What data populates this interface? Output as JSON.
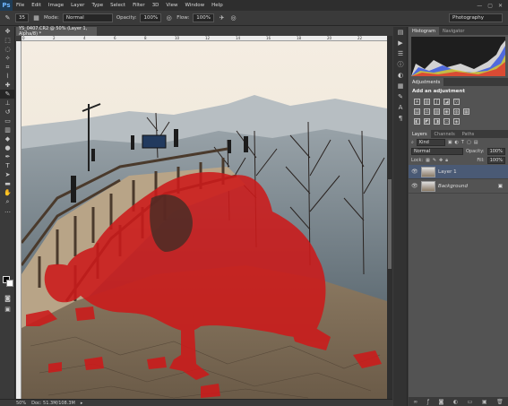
{
  "app": {
    "logo": "Ps"
  },
  "menu": [
    "File",
    "Edit",
    "Image",
    "Layer",
    "Type",
    "Select",
    "Filter",
    "3D",
    "View",
    "Window",
    "Help"
  ],
  "window_controls": [
    "—",
    "▢",
    "✕"
  ],
  "options": {
    "brush_size": "35",
    "mode_label": "Mode:",
    "mode_value": "Normal",
    "opacity_label": "Opacity:",
    "opacity_value": "100%",
    "flow_label": "Flow:",
    "flow_value": "100%",
    "workspace": "Photography"
  },
  "document": {
    "tab_title": "YS_0407.CR2 @ 50% (Layer 1, Alpha/8) *",
    "ruler_ticks": [
      "0",
      "2",
      "4",
      "6",
      "8",
      "10",
      "12",
      "14",
      "16",
      "18",
      "20",
      "22"
    ],
    "zoom": "50%",
    "doc_info": "Doc: 51.3M/108.3M"
  },
  "panels": {
    "histogram_tab": "Histogram",
    "navigator_tab": "Navigator",
    "adjustments_tab": "Adjustments",
    "add_adjustment": "Add an adjustment",
    "layers_tab": "Layers",
    "channels_tab": "Channels",
    "paths_tab": "Paths",
    "kind_label": "Kind",
    "blend_mode": "Normal",
    "opacity_label": "Opacity:",
    "opacity_value": "100%",
    "lock_label": "Lock:",
    "fill_label": "Fill:",
    "fill_value": "100%",
    "layers": [
      {
        "name": "Layer 1",
        "selected": true
      },
      {
        "name": "Background",
        "selected": false
      }
    ]
  },
  "colors": {
    "mask_red": "#cc1a1a",
    "accent": "#4a5a75"
  }
}
